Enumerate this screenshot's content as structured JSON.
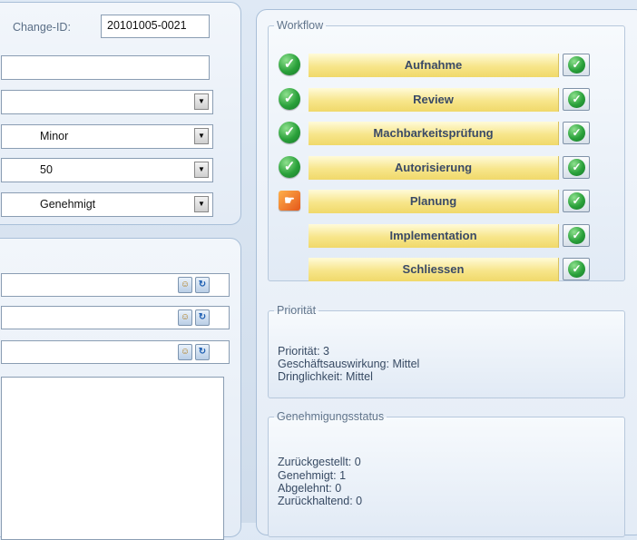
{
  "change": {
    "label": "Change-ID:",
    "value": "20101005-0021"
  },
  "fields": {
    "category": "",
    "impact": "Minor",
    "urgency": "50",
    "status": "Genehmigt"
  },
  "workflow": {
    "title": "Workflow",
    "steps": [
      {
        "label": "Aufnahme",
        "state": "done"
      },
      {
        "label": "Review",
        "state": "done"
      },
      {
        "label": "Machbarkeitsprüfung",
        "state": "done"
      },
      {
        "label": "Autorisierung",
        "state": "done"
      },
      {
        "label": "Planung",
        "state": "current"
      },
      {
        "label": "Implementation",
        "state": "pending"
      },
      {
        "label": "Schliessen",
        "state": "pending"
      }
    ]
  },
  "priority": {
    "title": "Priorität",
    "lines": [
      "Priorität: 3",
      "Geschäftsauswirkung: Mittel",
      "Dringlichkeit: Mittel"
    ]
  },
  "approval": {
    "title": "Genehmigungsstatus",
    "lines": [
      "Zurückgestellt: 0",
      "Genehmigt: 1",
      "Abgelehnt: 0",
      "Zurückhaltend: 0"
    ]
  },
  "icons": {
    "status_done": "check-circle-icon",
    "status_current": "hand-pointer-icon",
    "step_button": "check-circle-icon",
    "field_lookup": "lookup-icon",
    "field_refresh": "refresh-icon",
    "dropdown": "chevron-down-icon"
  },
  "colors": {
    "panel_bg": "#e8eff8",
    "step_bar": "#f7e58a",
    "done_green": "#2aa13a",
    "current_orange": "#e4571a"
  }
}
